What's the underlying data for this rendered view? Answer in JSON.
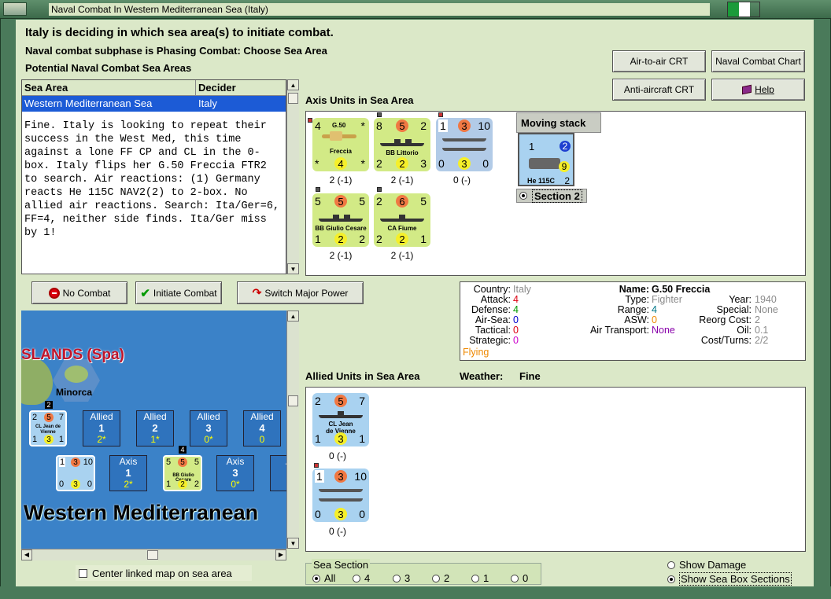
{
  "window": {
    "title": "Naval Combat In Western Mediterranean Sea (Italy)"
  },
  "header": {
    "title": "Italy is deciding in which sea area(s) to initiate combat.",
    "subphase": "Naval combat subphase is Phasing Combat: Choose Sea Area",
    "potential_label": "Potential Naval Combat Sea Areas"
  },
  "buttons": {
    "air_to_air": "Air-to-air CRT",
    "naval_chart": "Naval Combat Chart",
    "anti_aircraft": "Anti-aircraft CRT",
    "help": "Help",
    "no_combat": "No Combat",
    "initiate": "Initiate Combat",
    "switch": "Switch Major Power"
  },
  "sea_table": {
    "columns": [
      "Sea Area",
      "Decider"
    ],
    "rows": [
      [
        "Western Mediterranean Sea",
        "Italy"
      ]
    ]
  },
  "narrative": "Fine.  Italy is looking to repeat their success in the West Med, this time against a lone FF CP and CL in the 0-box.  Italy flips her G.50 Freccia FTR2 to search.  Air reactions:  (1) Germany reacts He 115C NAV2(2) to 2-box.  No allied air reactions.   Search: Ita/Ger=6, FF=4, neither side finds.  Ita/Ger miss by 1!",
  "axis": {
    "label": "Axis Units in Sea Area",
    "units": [
      {
        "tl": "4",
        "name": "G.50",
        "name2": "Freccia",
        "star": "*",
        "bl": "*",
        "mid": "4",
        "br": "*",
        "under": "2 (-1)"
      },
      {
        "tl": "8",
        "tc": "5",
        "tr": "2",
        "name": "BB Littorio",
        "bl": "2",
        "mid": "2",
        "br": "3",
        "under": "2 (-1)"
      },
      {
        "tl": "1",
        "tc": "3",
        "tr": "10",
        "bl": "0",
        "mid": "3",
        "br": "0",
        "under": "0 (-)"
      },
      {
        "tl": "5",
        "tc": "5",
        "tr": "5",
        "name": "BB Giulio Cesare",
        "bl": "1",
        "mid": "2",
        "br": "2",
        "under": "2 (-1)"
      },
      {
        "tl": "2",
        "tc": "6",
        "tr": "5",
        "name": "CA Fiume",
        "bl": "2",
        "mid": "2",
        "br": "1",
        "under": "2 (-1)"
      }
    ],
    "moving_stack": {
      "label": "Moving stack",
      "tl": "1",
      "tr": "2",
      "name": "He 115C",
      "br": "9",
      "br2": "2",
      "section": "Section 2"
    }
  },
  "info": {
    "country_k": "Country:",
    "country_v": "Italy",
    "attack_k": "Attack:",
    "attack_v": "4",
    "defense_k": "Defense:",
    "defense_v": "4",
    "airsea_k": "Air-Sea:",
    "airsea_v": "0",
    "tactical_k": "Tactical:",
    "tactical_v": "0",
    "strategic_k": "Strategic:",
    "strategic_v": "0",
    "flying": "Flying",
    "name_k": "Name:",
    "name_v": "G.50 Freccia",
    "type_k": "Type:",
    "type_v": "Fighter",
    "range_k": "Range:",
    "range_v": "4",
    "asw_k": "ASW:",
    "asw_v": "0",
    "airtrans_k": "Air Transport:",
    "airtrans_v": "None",
    "year_k": "Year:",
    "year_v": "1940",
    "special_k": "Special:",
    "special_v": "None",
    "reorg_k": "Reorg Cost:",
    "reorg_v": "2",
    "oil_k": "Oil:",
    "oil_v": "0.1",
    "cost_k": "Cost/Turns:",
    "cost_v": "2/2"
  },
  "allied": {
    "label": "Allied Units in Sea Area",
    "weather_label": "Weather:",
    "weather_value": "Fine",
    "units": [
      {
        "tl": "2",
        "tc": "5",
        "tr": "7",
        "name": "CL Jean",
        "name2": "de Vienne",
        "bl": "1",
        "mid": "3",
        "br": "1",
        "under": "0 (-)"
      },
      {
        "tl": "1",
        "tc": "3",
        "tr": "10",
        "bl": "0",
        "mid": "3",
        "br": "0",
        "under": "0 (-)"
      }
    ]
  },
  "map": {
    "islands": "SLANDS (Spa)",
    "minorca": "Minorca",
    "sea_name": "Western Mediterranean",
    "allied_boxes": [
      {
        "label": "Allied",
        "num": "1",
        "val": "2*"
      },
      {
        "label": "Allied",
        "num": "2",
        "val": "1*"
      },
      {
        "label": "Allied",
        "num": "3",
        "val": "0*"
      },
      {
        "label": "Allied",
        "num": "4",
        "val": "0"
      }
    ],
    "axis_boxes": [
      {
        "label": "Axis",
        "num": "1",
        "val": "2*"
      },
      {
        "label": "Axis",
        "num": "3",
        "val": "0*"
      },
      {
        "label": "A",
        "num": "",
        "val": ""
      }
    ],
    "mini_cl": {
      "tl": "2",
      "tc": "5",
      "tr": "7",
      "name": "CL Jean de Vienne",
      "bl": "1",
      "mid": "3",
      "br": "1",
      "badge": "2"
    },
    "mini_dd": {
      "tl": "1",
      "tc": "3",
      "tr": "10",
      "bl": "0",
      "mid": "3",
      "br": "0"
    },
    "mini_bb": {
      "tl": "5",
      "tc": "5",
      "tr": "5",
      "name": "BB Giulio Cesare",
      "bl": "1",
      "mid": "2",
      "br": "2",
      "badge": "4"
    }
  },
  "center_map": "Center linked map on sea area",
  "sea_section": {
    "label": "Sea Section",
    "options": [
      "All",
      "4",
      "3",
      "2",
      "1",
      "0"
    ],
    "selected": "All"
  },
  "show_damage": "Show Damage",
  "show_sections": "Show Sea Box Sections",
  "colors": {
    "selection": "#1c5bd6",
    "panel_bg": "#dbe8c8",
    "map_sea": "#3b82c8"
  }
}
